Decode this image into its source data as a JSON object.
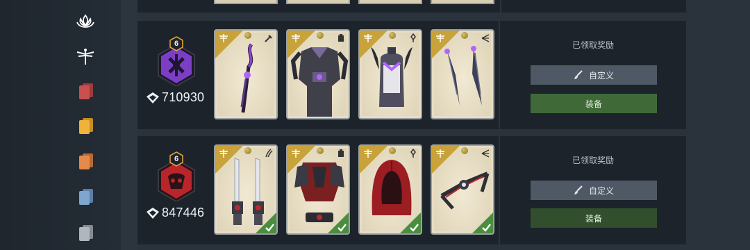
{
  "sidebar": {
    "icons": [
      {
        "name": "lotus-icon",
        "color": "#ffffff"
      },
      {
        "name": "dragonfly-icon",
        "color": "#ffffff"
      },
      {
        "name": "card-stack-red-icon",
        "color": "#c8514f"
      },
      {
        "name": "card-stack-yellow-icon",
        "color": "#f0b33a"
      },
      {
        "name": "card-stack-orange-icon",
        "color": "#e58a4a"
      },
      {
        "name": "card-stack-blue-icon",
        "color": "#7ea6cf"
      },
      {
        "name": "card-stack-gray-icon",
        "color": "#b0b6bd"
      }
    ]
  },
  "rows": [
    {
      "level": "6",
      "emblem_color": "#7c3fc4",
      "score": "710930",
      "reward_status": "已领取奖励",
      "customize_label": "自定义",
      "equip_label": "装备",
      "items": [
        {
          "name": "staff",
          "slot_icon": "weapon-icon",
          "color": "#7b3fbf",
          "checked": false
        },
        {
          "name": "armor",
          "slot_icon": "chest-icon",
          "color": "#6a5c89",
          "checked": false
        },
        {
          "name": "helmet",
          "slot_icon": "head-icon",
          "color": "#4e4e5e",
          "checked": false
        },
        {
          "name": "daggers",
          "slot_icon": "offhand-icon",
          "color": "#3d3f56",
          "checked": false
        }
      ]
    },
    {
      "level": "6",
      "emblem_color": "#b8262b",
      "score": "847446",
      "reward_status": "已领取奖励",
      "customize_label": "自定义",
      "equip_label": "装备",
      "items": [
        {
          "name": "blades",
          "slot_icon": "weapon-icon",
          "color": "#c9ced6",
          "checked": true
        },
        {
          "name": "armor",
          "slot_icon": "chest-icon",
          "color": "#7a2020",
          "checked": true
        },
        {
          "name": "hood",
          "slot_icon": "head-icon",
          "color": "#9c1e22",
          "checked": true
        },
        {
          "name": "throwing-star",
          "slot_icon": "offhand-icon",
          "color": "#2e2e36",
          "checked": true
        }
      ]
    }
  ]
}
